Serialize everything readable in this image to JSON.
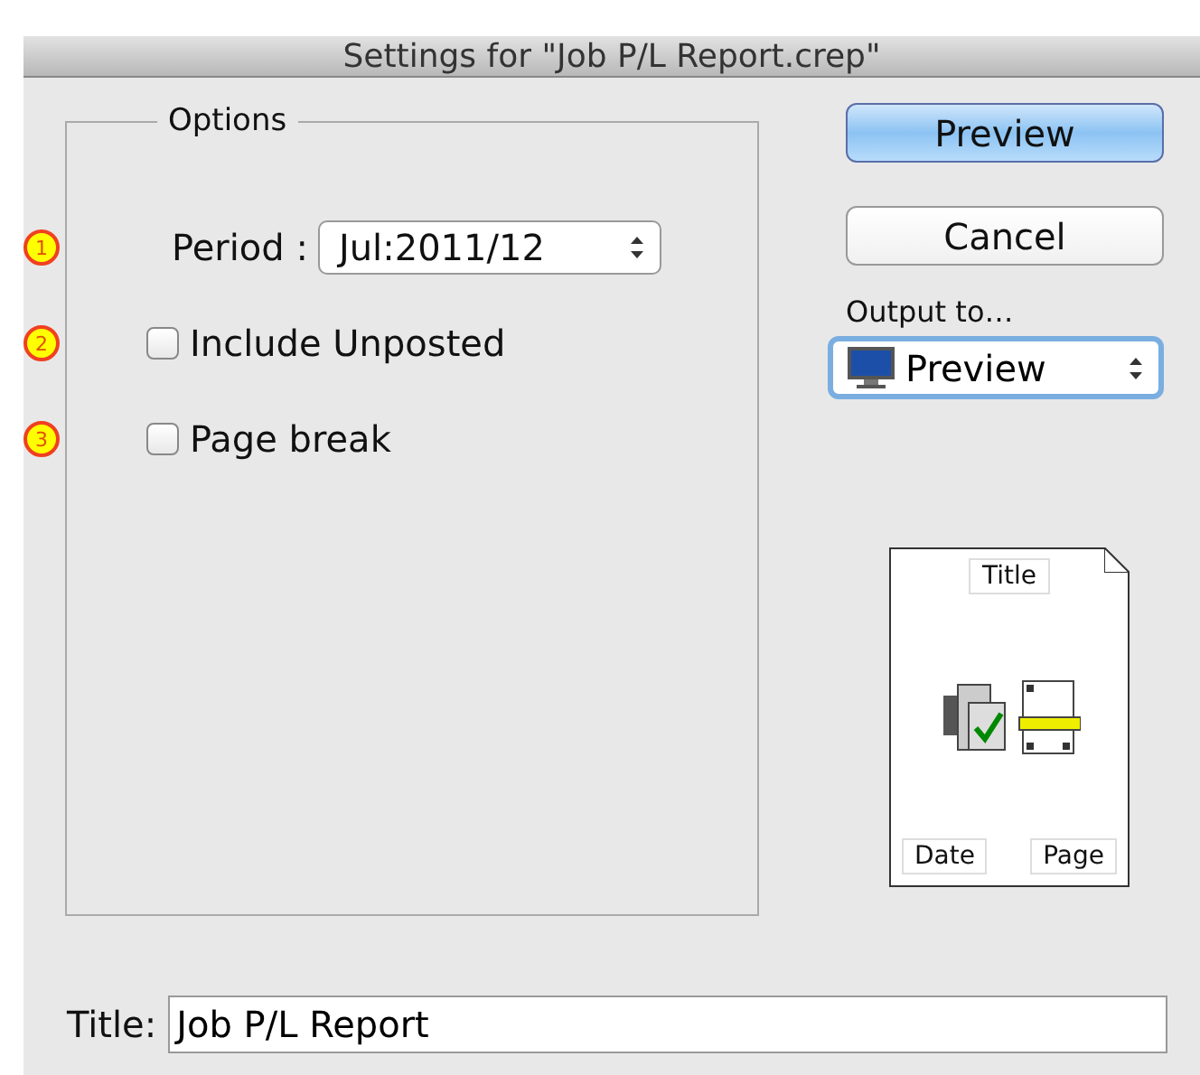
{
  "window": {
    "title": "Settings for \"Job P/L Report.crep\""
  },
  "options": {
    "legend": "Options",
    "rows": [
      {
        "kind": "select",
        "marker": "1",
        "label": "Period :",
        "value": "Jul:2011/12"
      },
      {
        "kind": "checkbox",
        "marker": "2",
        "label": "Include Unposted",
        "checked": false
      },
      {
        "kind": "checkbox",
        "marker": "3",
        "label": "Page break",
        "checked": false
      }
    ]
  },
  "buttons": [
    {
      "label": "Preview",
      "default": true
    },
    {
      "label": "Cancel",
      "default": false
    }
  ],
  "output": {
    "label": "Output to…",
    "value": "Preview"
  },
  "page_preview": {
    "header": "Title",
    "footer_left": "Date",
    "footer_right": "Page"
  },
  "title_field": {
    "label": "Title:",
    "value": "Job P/L Report"
  }
}
